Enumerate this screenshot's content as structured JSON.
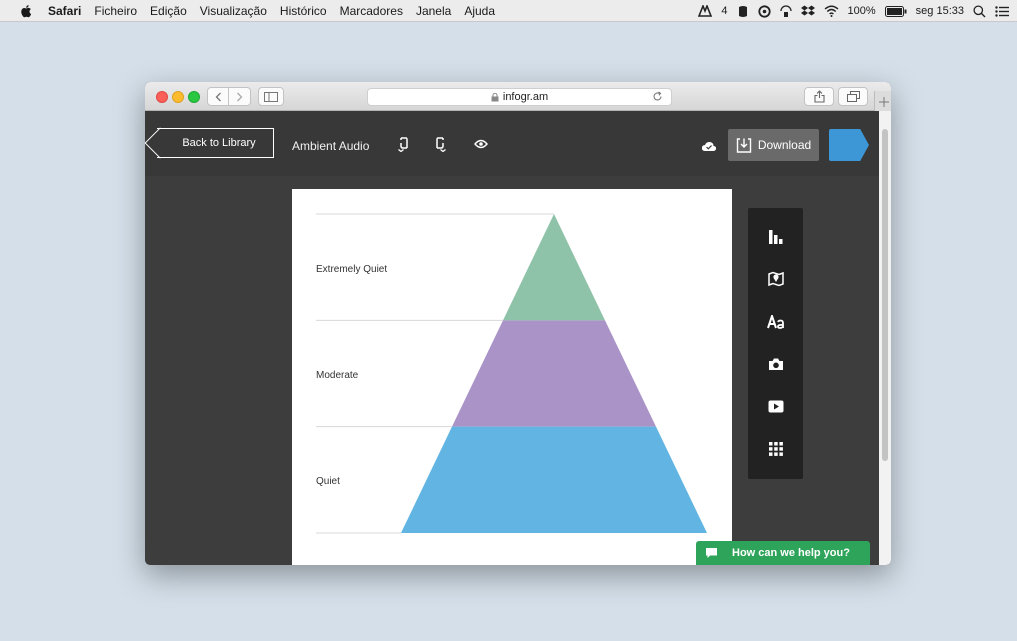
{
  "menubar": {
    "app_name": "Safari",
    "items": [
      "Ficheiro",
      "Edição",
      "Visualização",
      "Histórico",
      "Marcadores",
      "Janela",
      "Ajuda"
    ],
    "status": {
      "notification_count": "4",
      "battery": "100%",
      "clock": "seg 15:33"
    }
  },
  "browser": {
    "url": "infogr.am"
  },
  "app": {
    "back_label": "Back to Library",
    "doc_title": "Ambient Audio",
    "download_label": "Download",
    "publish_color": "#3d96d6"
  },
  "chart_data": {
    "type": "pyramid",
    "categories": [
      "Extremely Quiet",
      "Moderate",
      "Quiet"
    ],
    "colors": [
      "#8fc3a9",
      "#aa93c7",
      "#62b5e2"
    ]
  },
  "tools": [
    "bar-chart-icon",
    "map-icon",
    "text-icon",
    "camera-icon",
    "video-icon",
    "grid-icon"
  ],
  "help": {
    "label": "How can we help you?"
  }
}
